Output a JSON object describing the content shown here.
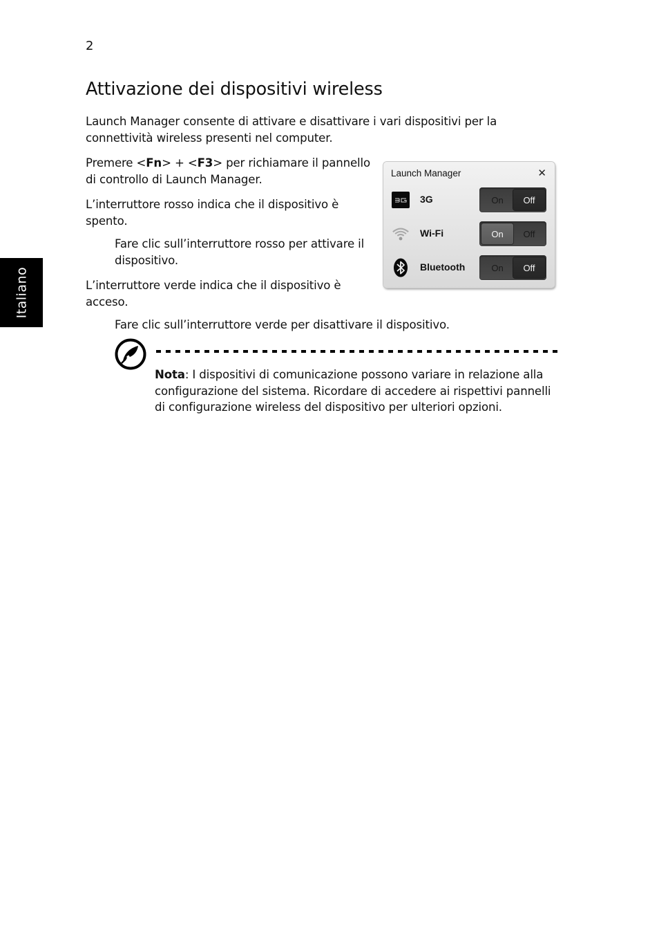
{
  "page_number": "2",
  "side_tab": "Italiano",
  "title": "Attivazione dei dispositivi wireless",
  "intro": "Launch Manager consente di attivare e disattivare i vari dispositivi per la connettività wireless presenti nel computer.",
  "press": {
    "prefix": "Premere <",
    "key1": "Fn",
    "middle": "> + <",
    "key2": "F3",
    "suffix": "> per richiamare il pannello di controllo di Launch Manager."
  },
  "red_switch": "L’interruttore rosso indica che il dispositivo è spento.",
  "red_switch_action": "Fare clic sull’interruttore rosso per attivare il dispositivo.",
  "green_switch": "L’interruttore verde indica che il dispositivo è acceso.",
  "green_switch_action": "Fare clic sull’interruttore verde per disattivare il dispositivo.",
  "launch_manager": {
    "title": "Launch Manager",
    "close_icon": "close-icon",
    "devices": [
      {
        "label": "3G",
        "icon": "3g-icon",
        "on_label": "On",
        "off_label": "Off",
        "state": "off"
      },
      {
        "label": "Wi-Fi",
        "icon": "wifi-icon",
        "on_label": "On",
        "off_label": "Off",
        "state": "on"
      },
      {
        "label": "Bluetooth",
        "icon": "bluetooth-icon",
        "on_label": "On",
        "off_label": "Off",
        "state": "off"
      }
    ]
  },
  "note": {
    "icon": "note-pen-icon",
    "label": "Nota",
    "text": ": I dispositivi di comunicazione possono variare in relazione alla configurazione del sistema. Ricordare di accedere ai rispettivi pannelli di configurazione wireless del dispositivo per ulteriori opzioni."
  }
}
